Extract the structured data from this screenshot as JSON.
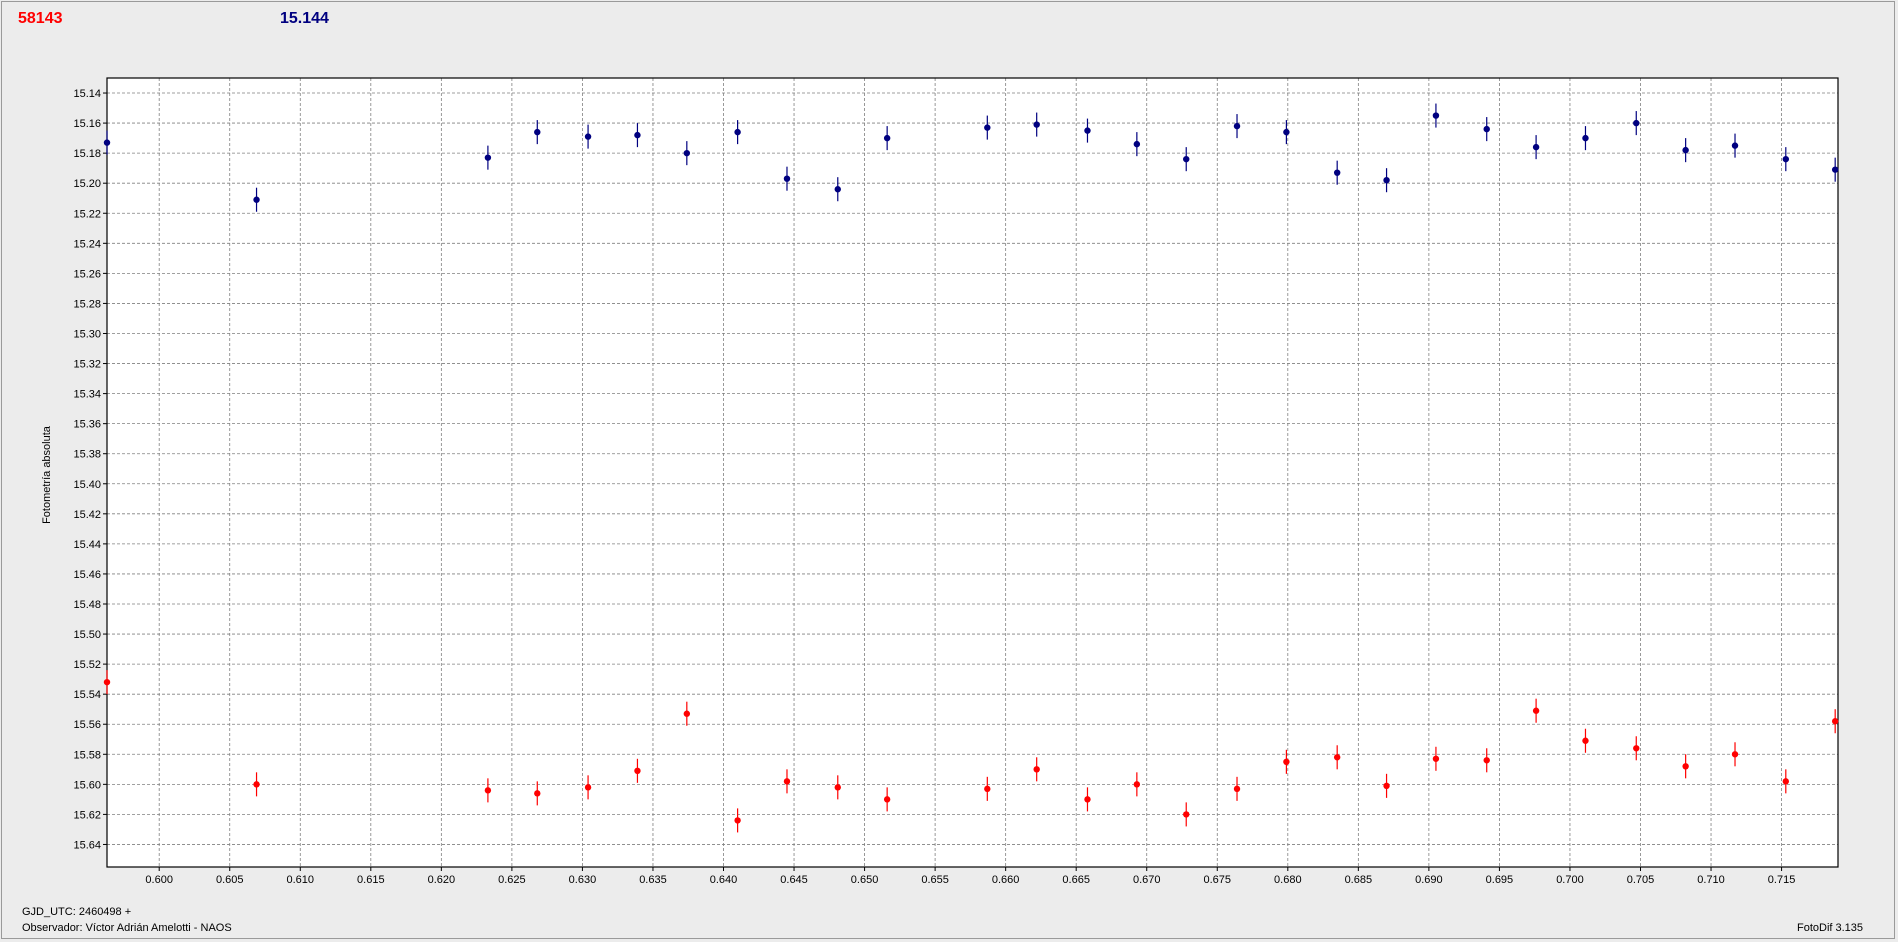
{
  "header": {
    "left_value": "58143",
    "right_value": "15.144"
  },
  "footer": {
    "line1": "GJD_UTC: 2460498 +",
    "line2": "Observador: Víctor Adrián Amelotti - NAOS",
    "software": "FotoDif 3.135"
  },
  "colors": {
    "series_a": "#ff0000",
    "series_b": "#000080"
  },
  "chart_data": {
    "type": "scatter",
    "ylabel": "Fotometría absoluta",
    "xlabel": "",
    "xlim": [
      0.5963,
      0.719
    ],
    "ylim": [
      15.13,
      15.655
    ],
    "y_inverted": true,
    "grid": true,
    "x_ticks": [
      "0.600",
      "0.605",
      "0.610",
      "0.615",
      "0.620",
      "0.625",
      "0.630",
      "0.635",
      "0.640",
      "0.645",
      "0.650",
      "0.655",
      "0.660",
      "0.665",
      "0.670",
      "0.675",
      "0.680",
      "0.685",
      "0.690",
      "0.695",
      "0.700",
      "0.705",
      "0.710",
      "0.715"
    ],
    "y_ticks": [
      "15.14",
      "15.16",
      "15.18",
      "15.20",
      "15.22",
      "15.24",
      "15.26",
      "15.28",
      "15.30",
      "15.32",
      "15.34",
      "15.36",
      "15.38",
      "15.40",
      "15.42",
      "15.44",
      "15.46",
      "15.48",
      "15.50",
      "15.52",
      "15.54",
      "15.56",
      "15.58",
      "15.60",
      "15.62",
      "15.64"
    ],
    "x": [
      0.5963,
      0.6069,
      0.6233,
      0.6268,
      0.6304,
      0.6339,
      0.6374,
      0.641,
      0.6445,
      0.6481,
      0.6516,
      0.6587,
      0.6622,
      0.6658,
      0.6693,
      0.6728,
      0.6764,
      0.6799,
      0.6835,
      0.687,
      0.6905,
      0.6941,
      0.6976,
      0.7011,
      0.7047,
      0.7082,
      0.7117,
      0.7153,
      0.7188
    ],
    "series": [
      {
        "color": "#000080",
        "values": [
          15.173,
          15.211,
          15.183,
          15.166,
          15.169,
          15.168,
          15.18,
          15.166,
          15.197,
          15.204,
          15.17,
          15.163,
          15.161,
          15.165,
          15.174,
          15.184,
          15.162,
          15.166,
          15.193,
          15.198,
          15.155,
          15.164,
          15.176,
          15.17,
          15.16,
          15.178,
          15.175,
          15.184,
          15.191
        ]
      },
      {
        "color": "#ff0000",
        "values": [
          15.532,
          15.6,
          15.604,
          15.606,
          15.602,
          15.591,
          15.553,
          15.624,
          15.598,
          15.602,
          15.61,
          15.603,
          15.59,
          15.61,
          15.6,
          15.62,
          15.603,
          15.585,
          15.582,
          15.601,
          15.583,
          15.584,
          15.551,
          15.571,
          15.576,
          15.588,
          15.58,
          15.598,
          15.558
        ]
      }
    ],
    "error": 0.008
  }
}
